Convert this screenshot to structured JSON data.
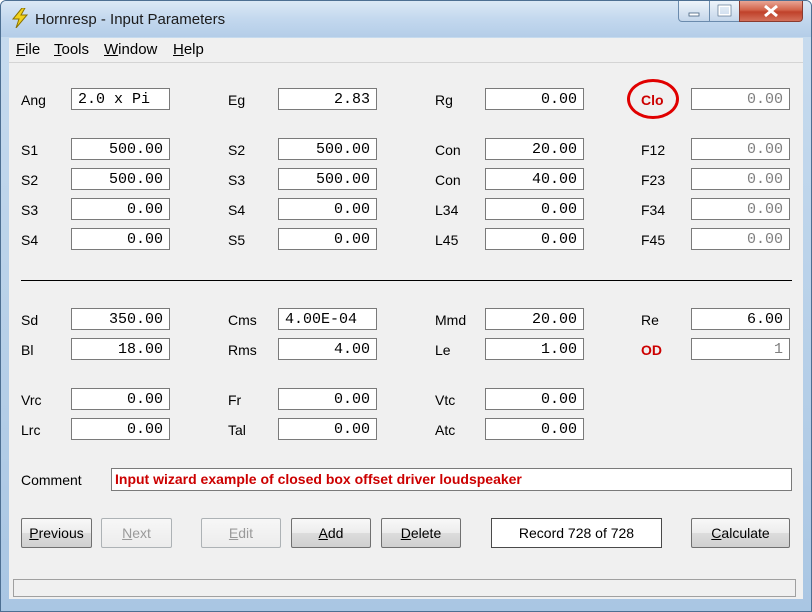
{
  "window": {
    "title": "Hornresp - Input Parameters"
  },
  "menu": {
    "file": "File",
    "tools": "Tools",
    "window": "Window",
    "help": "Help"
  },
  "rows_top": [
    {
      "l1": "Ang",
      "v1": "2.0 x Pi",
      "l2": "Eg",
      "v2": "2.83",
      "l3": "Rg",
      "v3": "0.00",
      "l4": "Clo",
      "v4": "0.00"
    },
    {
      "l1": "S1",
      "v1": "500.00",
      "l2": "S2",
      "v2": "500.00",
      "l3": "Con",
      "v3": "20.00",
      "l4": "F12",
      "v4": "0.00"
    },
    {
      "l1": "S2",
      "v1": "500.00",
      "l2": "S3",
      "v2": "500.00",
      "l3": "Con",
      "v3": "40.00",
      "l4": "F23",
      "v4": "0.00"
    },
    {
      "l1": "S3",
      "v1": "0.00",
      "l2": "S4",
      "v2": "0.00",
      "l3": "L34",
      "v3": "0.00",
      "l4": "F34",
      "v4": "0.00"
    },
    {
      "l1": "S4",
      "v1": "0.00",
      "l2": "S5",
      "v2": "0.00",
      "l3": "L45",
      "v3": "0.00",
      "l4": "F45",
      "v4": "0.00"
    }
  ],
  "rows_driver": [
    {
      "l1": "Sd",
      "v1": "350.00",
      "l2": "Cms",
      "v2": "4.00E-04",
      "l3": "Mmd",
      "v3": "20.00",
      "l4": "Re",
      "v4": "6.00"
    },
    {
      "l1": "Bl",
      "v1": "18.00",
      "l2": "Rms",
      "v2": "4.00",
      "l3": "Le",
      "v3": "1.00",
      "l4": "OD",
      "v4": "1"
    }
  ],
  "rows_chamber": [
    {
      "l1": "Vrc",
      "v1": "0.00",
      "l2": "Fr",
      "v2": "0.00",
      "l3": "Vtc",
      "v3": "0.00"
    },
    {
      "l1": "Lrc",
      "v1": "0.00",
      "l2": "Tal",
      "v2": "0.00",
      "l3": "Atc",
      "v3": "0.00"
    }
  ],
  "comment": {
    "label": "Comment",
    "value": "Input wizard example of closed box offset driver loudspeaker"
  },
  "buttons": {
    "previous": "Previous",
    "next": "Next",
    "edit": "Edit",
    "add": "Add",
    "delete": "Delete",
    "calculate": "Calculate"
  },
  "record": "Record 728 of 728",
  "colors": {
    "highlight_red": "#cc0000",
    "annotation_circle": "#e00000"
  },
  "icons": {
    "app": "lightning-bolt-icon",
    "minimize": "minimize-icon",
    "maximize": "maximize-icon",
    "close": "close-icon"
  }
}
